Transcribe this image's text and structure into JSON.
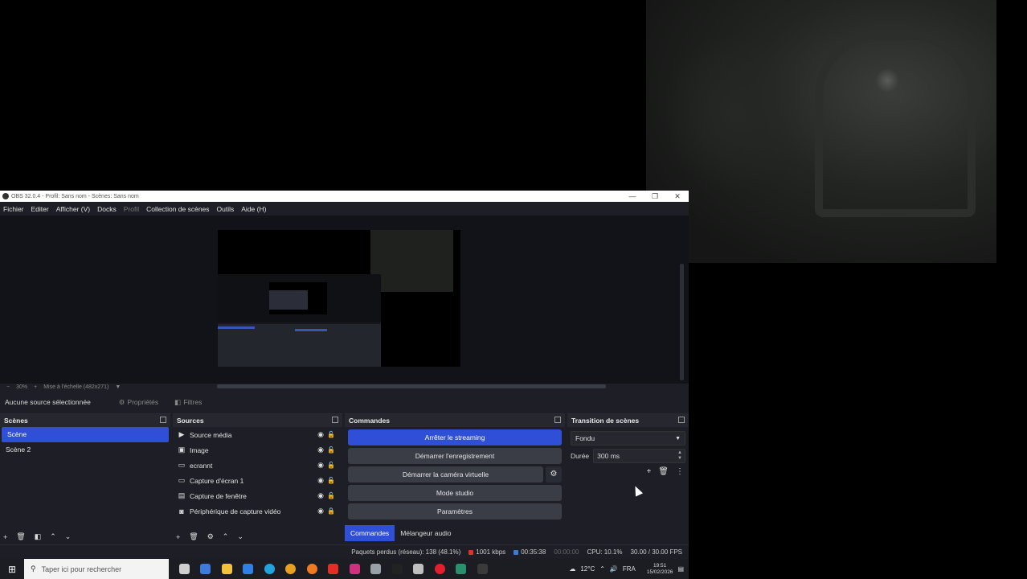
{
  "window": {
    "title": "OBS 32.0.4 - Profil: Sans nom - Scènes: Sans nom",
    "controls": [
      "—",
      "❐",
      "✕"
    ]
  },
  "menu": [
    "Fichier",
    "Editer",
    "Afficher (V)",
    "Docks",
    "Profil",
    "Collection de scènes",
    "Outils",
    "Aide (H)"
  ],
  "zoom": {
    "minus": "−",
    "percent": "30%",
    "plus": "+",
    "mode": "Mise à l'échelle (482x271)"
  },
  "context": {
    "no_source": "Aucune source sélectionnée",
    "properties": "Propriétés",
    "filters": "Filtres"
  },
  "scenes": {
    "title": "Scènes",
    "items": [
      "Scène",
      "Scène 2"
    ],
    "active_index": 0
  },
  "sources": {
    "title": "Sources",
    "items": [
      {
        "label": "Source média",
        "icon": "play-icon",
        "glyph": "▶"
      },
      {
        "label": "Image",
        "icon": "image-icon",
        "glyph": "▣"
      },
      {
        "label": "ecrannt",
        "icon": "monitor-icon",
        "glyph": "▭"
      },
      {
        "label": "Capture d'écran 1",
        "icon": "monitor-icon",
        "glyph": "▭"
      },
      {
        "label": "Capture de fenêtre",
        "icon": "window-icon",
        "glyph": "▤"
      },
      {
        "label": "Périphérique de capture vidéo",
        "icon": "camera-icon",
        "glyph": "◙"
      }
    ]
  },
  "commands": {
    "title": "Commandes",
    "stop_streaming": "Arrêter le streaming",
    "start_recording": "Démarrer l'enregistrement",
    "start_virtualcam": "Démarrer la caméra virtuelle",
    "studio_mode": "Mode studio",
    "settings": "Paramètres",
    "tabs": [
      "Commandes",
      "Mélangeur audio"
    ]
  },
  "transitions": {
    "title": "Transition de scènes",
    "selected": "Fondu",
    "duration_label": "Durée",
    "duration_value": "300 ms"
  },
  "status": {
    "dropped": "Paquets perdus (réseau): 138 (48.1%)",
    "bitrate": "1001 kbps",
    "stream_time": "00:35:38",
    "rec_time": "00:00:00",
    "cpu": "CPU: 10.1%",
    "fps": "30.00 / 30.00 FPS",
    "colors": {
      "live": "#d9342b",
      "stream": "#3a7bd5"
    }
  },
  "taskbar": {
    "search_placeholder": "Taper ici pour rechercher",
    "weather": "12°C",
    "lang": "FRA",
    "time": "19:51",
    "date": "15/02/2026",
    "icons": [
      {
        "name": "task-view-icon",
        "color": "#cfcfcf"
      },
      {
        "name": "calculator-icon",
        "color": "#3d7ad9"
      },
      {
        "name": "file-explorer-icon",
        "color": "#f2c23a"
      },
      {
        "name": "app-blue-icon",
        "color": "#2f7fe8"
      },
      {
        "name": "edge-icon",
        "color": "#1fa4e0"
      },
      {
        "name": "chrome-icon",
        "color": "#e9a020"
      },
      {
        "name": "firefox-icon",
        "color": "#ef7a22"
      },
      {
        "name": "youtube-icon",
        "color": "#e52d27"
      },
      {
        "name": "instagram-icon",
        "color": "#d1307e"
      },
      {
        "name": "camera-app-icon",
        "color": "#9aa0a8"
      },
      {
        "name": "tiktok-icon",
        "color": "#222222"
      },
      {
        "name": "microphone-app-icon",
        "color": "#bfbfbf"
      },
      {
        "name": "opera-icon",
        "color": "#e0202d"
      },
      {
        "name": "capcut-icon",
        "color": "#2a8f6c"
      },
      {
        "name": "obs-icon",
        "color": "#3a3a3a"
      }
    ]
  }
}
